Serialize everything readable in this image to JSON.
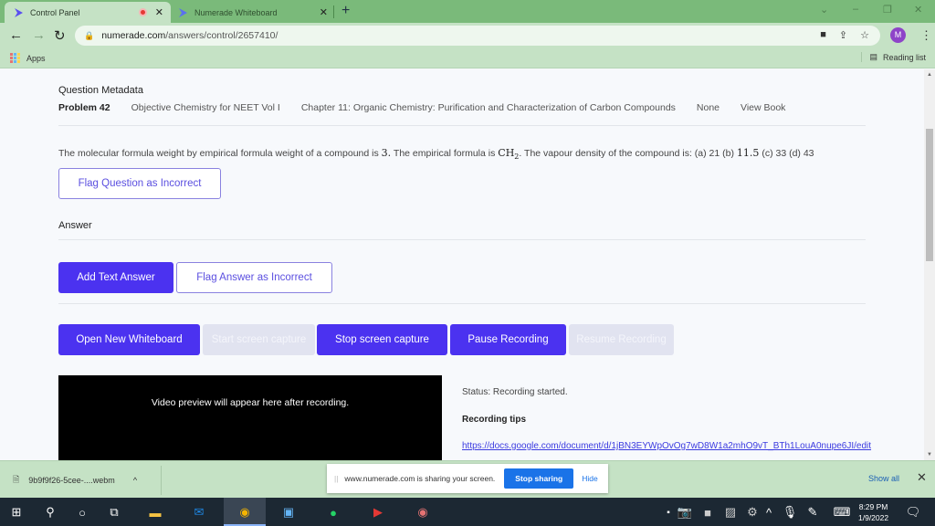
{
  "browser": {
    "tabs": [
      {
        "title": "Control Panel",
        "active": true,
        "recording": true
      },
      {
        "title": "Numerade Whiteboard",
        "active": false
      }
    ],
    "url_host": "numerade.com",
    "url_path": "/answers/control/2657410/",
    "profile_initial": "M",
    "bookmarks": {
      "apps_label": "Apps",
      "reading_list_label": "Reading list"
    }
  },
  "metadata": {
    "heading": "Question Metadata",
    "problem": "Problem 42",
    "book": "Objective Chemistry for NEET Vol I",
    "chapter": "Chapter 11: Organic Chemistry: Purification and Characterization of Carbon Compounds",
    "section": "None",
    "view_book": "View Book"
  },
  "question": {
    "text_1": "The molecular formula weight by empirical formula weight of a compound is ",
    "math_1": "3.",
    "text_2": " The empirical formula is ",
    "math_2": "CH",
    "math_2_sub": "2",
    "text_3": ". The vapour density of the compound is: (a) 21 (b) ",
    "math_3": "11.5",
    "text_4": " (c) 33 (d) 43",
    "flag_button": "Flag Question as Incorrect"
  },
  "answer": {
    "heading": "Answer",
    "add_text_button": "Add Text Answer",
    "flag_button": "Flag Answer as Incorrect"
  },
  "recording": {
    "open_whiteboard": "Open New Whiteboard",
    "start_capture": "Start screen capture",
    "stop_capture": "Stop screen capture",
    "pause": "Pause Recording",
    "resume": "Resume Recording",
    "preview_text": "Video preview will appear here after recording.",
    "status": "Status: Recording started.",
    "tips_heading": "Recording tips",
    "tips_link": "https://docs.google.com/document/d/1jBN3EYWpOvOg7wD8W1a2mhO9vT_BTh1LouA0nupe6JI/edit"
  },
  "downloads": {
    "file": "9b9f9f26-5cee-....webm",
    "share_message": "www.numerade.com is sharing your screen.",
    "stop_sharing": "Stop sharing",
    "hide": "Hide",
    "show_all": "Show all"
  },
  "taskbar": {
    "time": "8:29 PM",
    "date": "1/9/2022"
  },
  "colors": {
    "primary": "#4b32f0",
    "browser_frame": "#7aba7a",
    "share_blue": "#1a73e8"
  }
}
